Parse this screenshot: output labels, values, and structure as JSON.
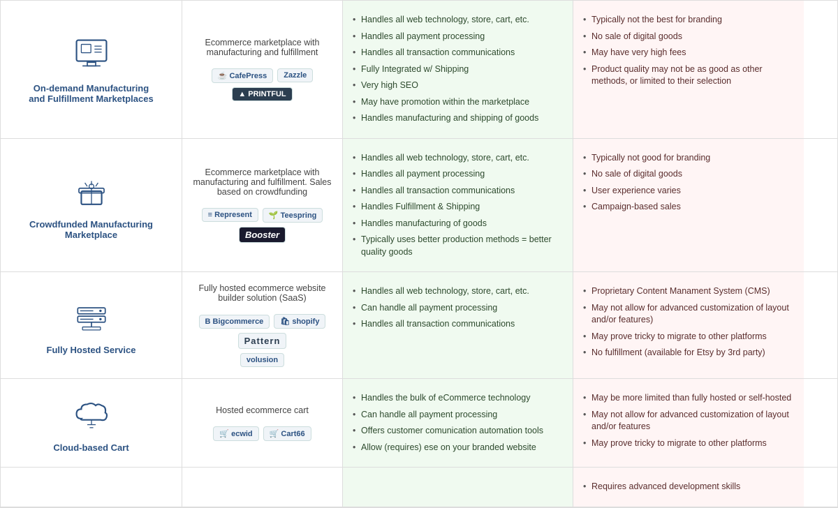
{
  "rows": [
    {
      "id": "on-demand",
      "icon": "monitor",
      "type_name": "On-demand Manufacturing\nand Fulfillment Marketplaces",
      "description": "Ecommerce marketplace with\nmanufacturing and fulfillment",
      "logos": [
        "CafePress",
        "Zazzle",
        "▲ PRINTFUL"
      ],
      "pros": [
        "Handles all web technology, store, cart, etc.",
        "Handles all payment processing",
        "Handles all transaction communications",
        "Fully Integrated w/ Shipping",
        "Very high SEO",
        "May have promotion within the marketplace",
        "Handles manufacturing and shipping of goods"
      ],
      "cons": [
        "Typically not the best for branding",
        "No sale of digital goods",
        "May have very high fees",
        "Product quality may not be as good as other methods, or limited to their selection"
      ]
    },
    {
      "id": "crowdfunded",
      "icon": "crowd",
      "type_name": "Crowdfunded Manufacturing\nMarketplace",
      "description": "Ecommerce marketplace with\nmanufacturing and fulfillment. Sales\nbased on crowdfunding",
      "logos": [
        "Represent",
        "Teespring",
        "Booster"
      ],
      "pros": [
        "Handles all web technology, store, cart, etc.",
        "Handles all payment processing",
        "Handles all transaction communications",
        "Handles Fulfillment & Shipping",
        "Handles manufacturing of goods",
        "Typically uses better production methods = better quality goods"
      ],
      "cons": [
        "Typically not good for branding",
        "No sale of digital goods",
        "User experience varies",
        "Campaign-based sales"
      ]
    },
    {
      "id": "fully-hosted",
      "icon": "hosted",
      "type_name": "Fully Hosted Service",
      "description": "Fully hosted ecommerce website\nbuilder solution (SaaS)",
      "logos": [
        "Bigcommerce",
        "shopify",
        "Pattern",
        "volusion"
      ],
      "pros": [
        "Handles all web technology, store, cart, etc.",
        "Can handle all payment processing",
        "Handles all transaction communications"
      ],
      "cons": [
        "Proprietary Content Manament System (CMS)",
        "May not allow for advanced customization of layout and/or features)",
        "May prove tricky to migrate to other platforms",
        "No fulfillment (available for Etsy by 3rd party)"
      ]
    },
    {
      "id": "cloud-cart",
      "icon": "cloud",
      "type_name": "Cloud-based Cart",
      "description": "Hosted ecommerce cart",
      "logos": [
        "ecwid",
        "Cart66"
      ],
      "pros": [
        "Handles the bulk of eCommerce technology",
        "Can handle all payment processing",
        "Offers customer comunication automation tools",
        "Allow (requires) ese on your branded website"
      ],
      "cons": [
        "May be more limited than fully hosted or self-hosted",
        "May not allow for advanced customization of layout and/or features",
        "May prove tricky to migrate to other platforms"
      ]
    }
  ],
  "partial_row": {
    "cons_partial": [
      "Requires advanced development skills"
    ]
  }
}
